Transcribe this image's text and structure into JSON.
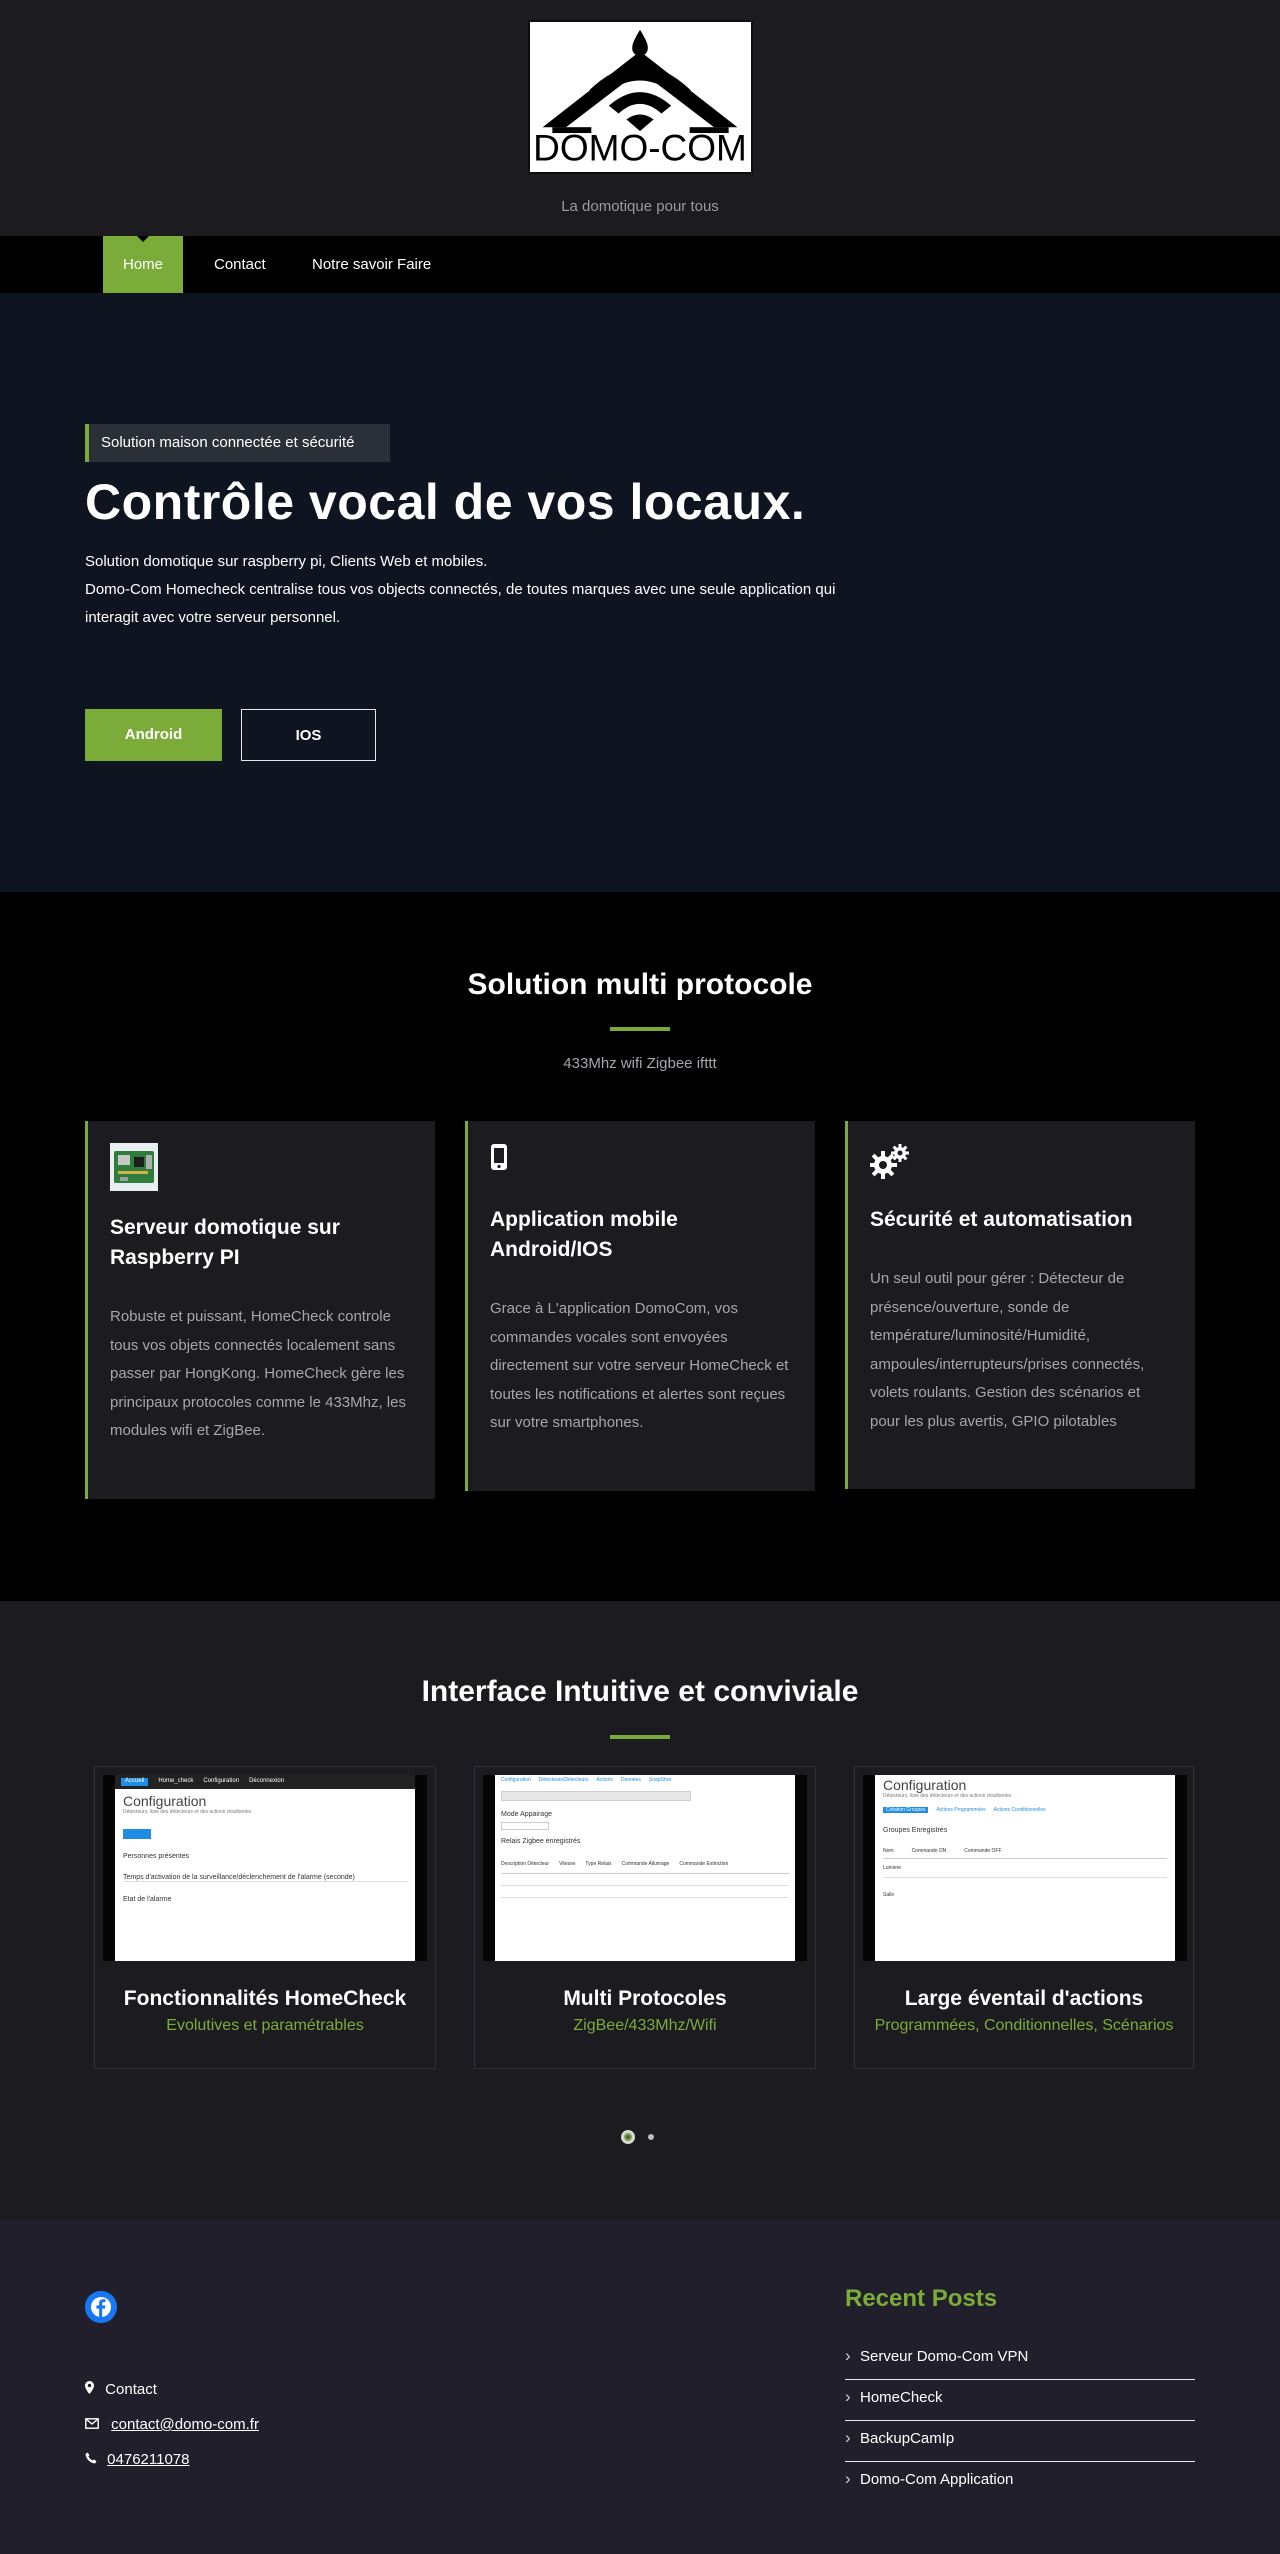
{
  "header": {
    "logo_text": "DOMO-COM",
    "tagline": "La domotique pour tous"
  },
  "nav": {
    "items": [
      "Home",
      "Contact",
      "Notre savoir Faire"
    ],
    "active": "Home"
  },
  "hero": {
    "badge": "Solution maison connectée et sécurité",
    "title": "Contrôle vocal de vos locaux.",
    "line1": "Solution domotique sur raspberry pi, Clients Web et mobiles.",
    "line2": "Domo-Com Homecheck centralise tous vos objects connectés, de toutes marques avec une seule application qui interagit avec votre serveur personnel.",
    "btn_android": "Android",
    "btn_ios": "IOS"
  },
  "features": {
    "title": "Solution multi protocole",
    "subtitle": "433Mhz wifi Zigbee ifttt",
    "cards": [
      {
        "icon": "raspberry-pi-board-icon",
        "title": "Serveur domotique sur Raspberry PI",
        "text": "Robuste et puissant, HomeCheck controle tous vos objets connectés localement sans passer par HongKong. HomeCheck gère les principaux protocoles comme le 433Mhz, les modules wifi et ZigBee."
      },
      {
        "icon": "mobile-phone-icon",
        "title": "Application mobile Android/IOS",
        "text": "Grace à L'application DomoCom, vos commandes vocales sont envoyées directement sur votre serveur HomeCheck et toutes les notifications et alertes sont reçues sur votre smartphones."
      },
      {
        "icon": "gears-icon",
        "title": "Sécurité et automatisation",
        "text": "Un seul outil pour gérer : Détecteur de présence/ouverture, sonde de température/luminosité/Humidité, ampoules/interrupteurs/prises connectés, volets roulants. Gestion des scénarios et pour les plus avertis, GPIO pilotables"
      }
    ]
  },
  "interface": {
    "title": "Interface Intuitive et conviviale",
    "slides": [
      {
        "title": "Fonctionnalités HomeCheck",
        "subtitle": "Evolutives et paramétrables",
        "screen_heading": "Configuration",
        "screen_caption": "Détecteurs, liste des détecteurs et des actions résultantes",
        "screen_lines": [
          "Accueil",
          "Home_check",
          "Configuration",
          "Déconnexion",
          "Personnes présentes",
          "Temps d'activation de la surveillance/déclenchement de l'alarme (seconde)",
          "Etat de l'alarme"
        ]
      },
      {
        "title": "Multi Protocoles",
        "subtitle": "ZigBee/433Mhz/Wifi",
        "screen_heading": "Mode Appairage",
        "screen_caption": "Relais Zigbee enregistrés",
        "screen_lines": [
          "Configuration",
          "Détecteurs/Détecteurs",
          "Actions",
          "Données",
          "SnapShot",
          "Description Détecteur",
          "Vitesse",
          "Type Relais",
          "Commande Allumage",
          "Commande Extinction"
        ]
      },
      {
        "title": "Large éventail d'actions",
        "subtitle": "Programmées, Conditionnelles, Scénarios",
        "screen_heading": "Configuration",
        "screen_caption": "Groupes Enregistrés",
        "screen_lines": [
          "Détecteurs, liste des détecteurs et des actions résultantes",
          "Création Groupes",
          "Actions Programmées",
          "Actions Conditionnelles",
          "Nom",
          "Commande ON",
          "Commande OFF",
          "Lumiere",
          "Salle"
        ]
      }
    ],
    "active_dot": 0,
    "dot_count": 2
  },
  "footer": {
    "social_icon": "facebook-icon",
    "contact_label": "Contact",
    "email": "contact@domo-com.fr",
    "phone": "0476211078",
    "recent_title": "Recent Posts",
    "posts": [
      "Serveur Domo-Com VPN",
      "HomeCheck",
      "BackupCamIp",
      "Domo-Com Application"
    ]
  },
  "colors": {
    "accent": "#7bac3a",
    "header_bg": "#1b1b20",
    "hero_bg": "#0e1420",
    "footer_bg": "#211f2c"
  }
}
